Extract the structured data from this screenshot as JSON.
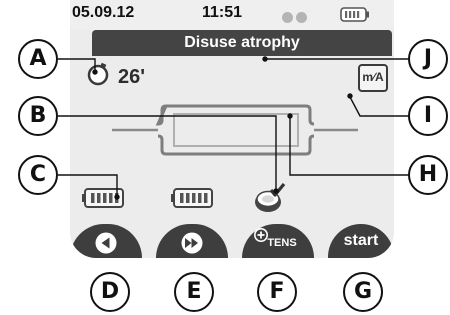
{
  "status": {
    "date": "05.09.12",
    "time": "11:51"
  },
  "program": {
    "title": "Disuse atrophy"
  },
  "session": {
    "timer_value": "26'"
  },
  "toolbar": {
    "mia_label": "m∕A"
  },
  "softkeys": {
    "start_label": "start",
    "tens_label": "TENS"
  },
  "callouts": [
    "A",
    "B",
    "C",
    "D",
    "E",
    "F",
    "G",
    "H",
    "I",
    "J"
  ],
  "icons": {
    "back": "triangle-left-icon",
    "forward": "double-triangle-right-icon",
    "timer": "timer-circle-icon",
    "electrode": "electrode-check-icon",
    "battery": "battery-icon"
  },
  "colors": {
    "title_bar": "#444444",
    "softkey": "#3e3e3e",
    "screen": "#ececec"
  }
}
